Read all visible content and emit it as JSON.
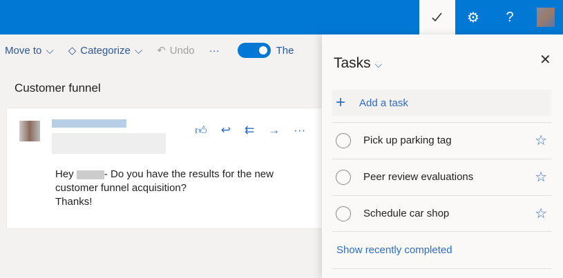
{
  "header": {
    "icons": [
      "todo-check-icon",
      "gear-icon",
      "help-icon"
    ],
    "help_label": "?"
  },
  "toolbar": {
    "move_to": "Move to",
    "categorize": "Categorize",
    "undo": "Undo",
    "more": "···",
    "toggle_label": "The",
    "toggle_on": true
  },
  "message": {
    "subject": "Customer funnel",
    "body_line1_a": "Hey",
    "body_line1_b": "- Do you have the results for the new",
    "body_line2": "customer funnel acquisition?",
    "body_line3": "Thanks!"
  },
  "tasks": {
    "title": "Tasks",
    "add_label": "Add a task",
    "items": [
      {
        "label": "Pick up parking tag"
      },
      {
        "label": "Peer review evaluations"
      },
      {
        "label": "Schedule car shop"
      }
    ],
    "show_completed": "Show recently completed"
  },
  "colors": {
    "brand": "#0078d4",
    "link": "#2b6cc4"
  }
}
